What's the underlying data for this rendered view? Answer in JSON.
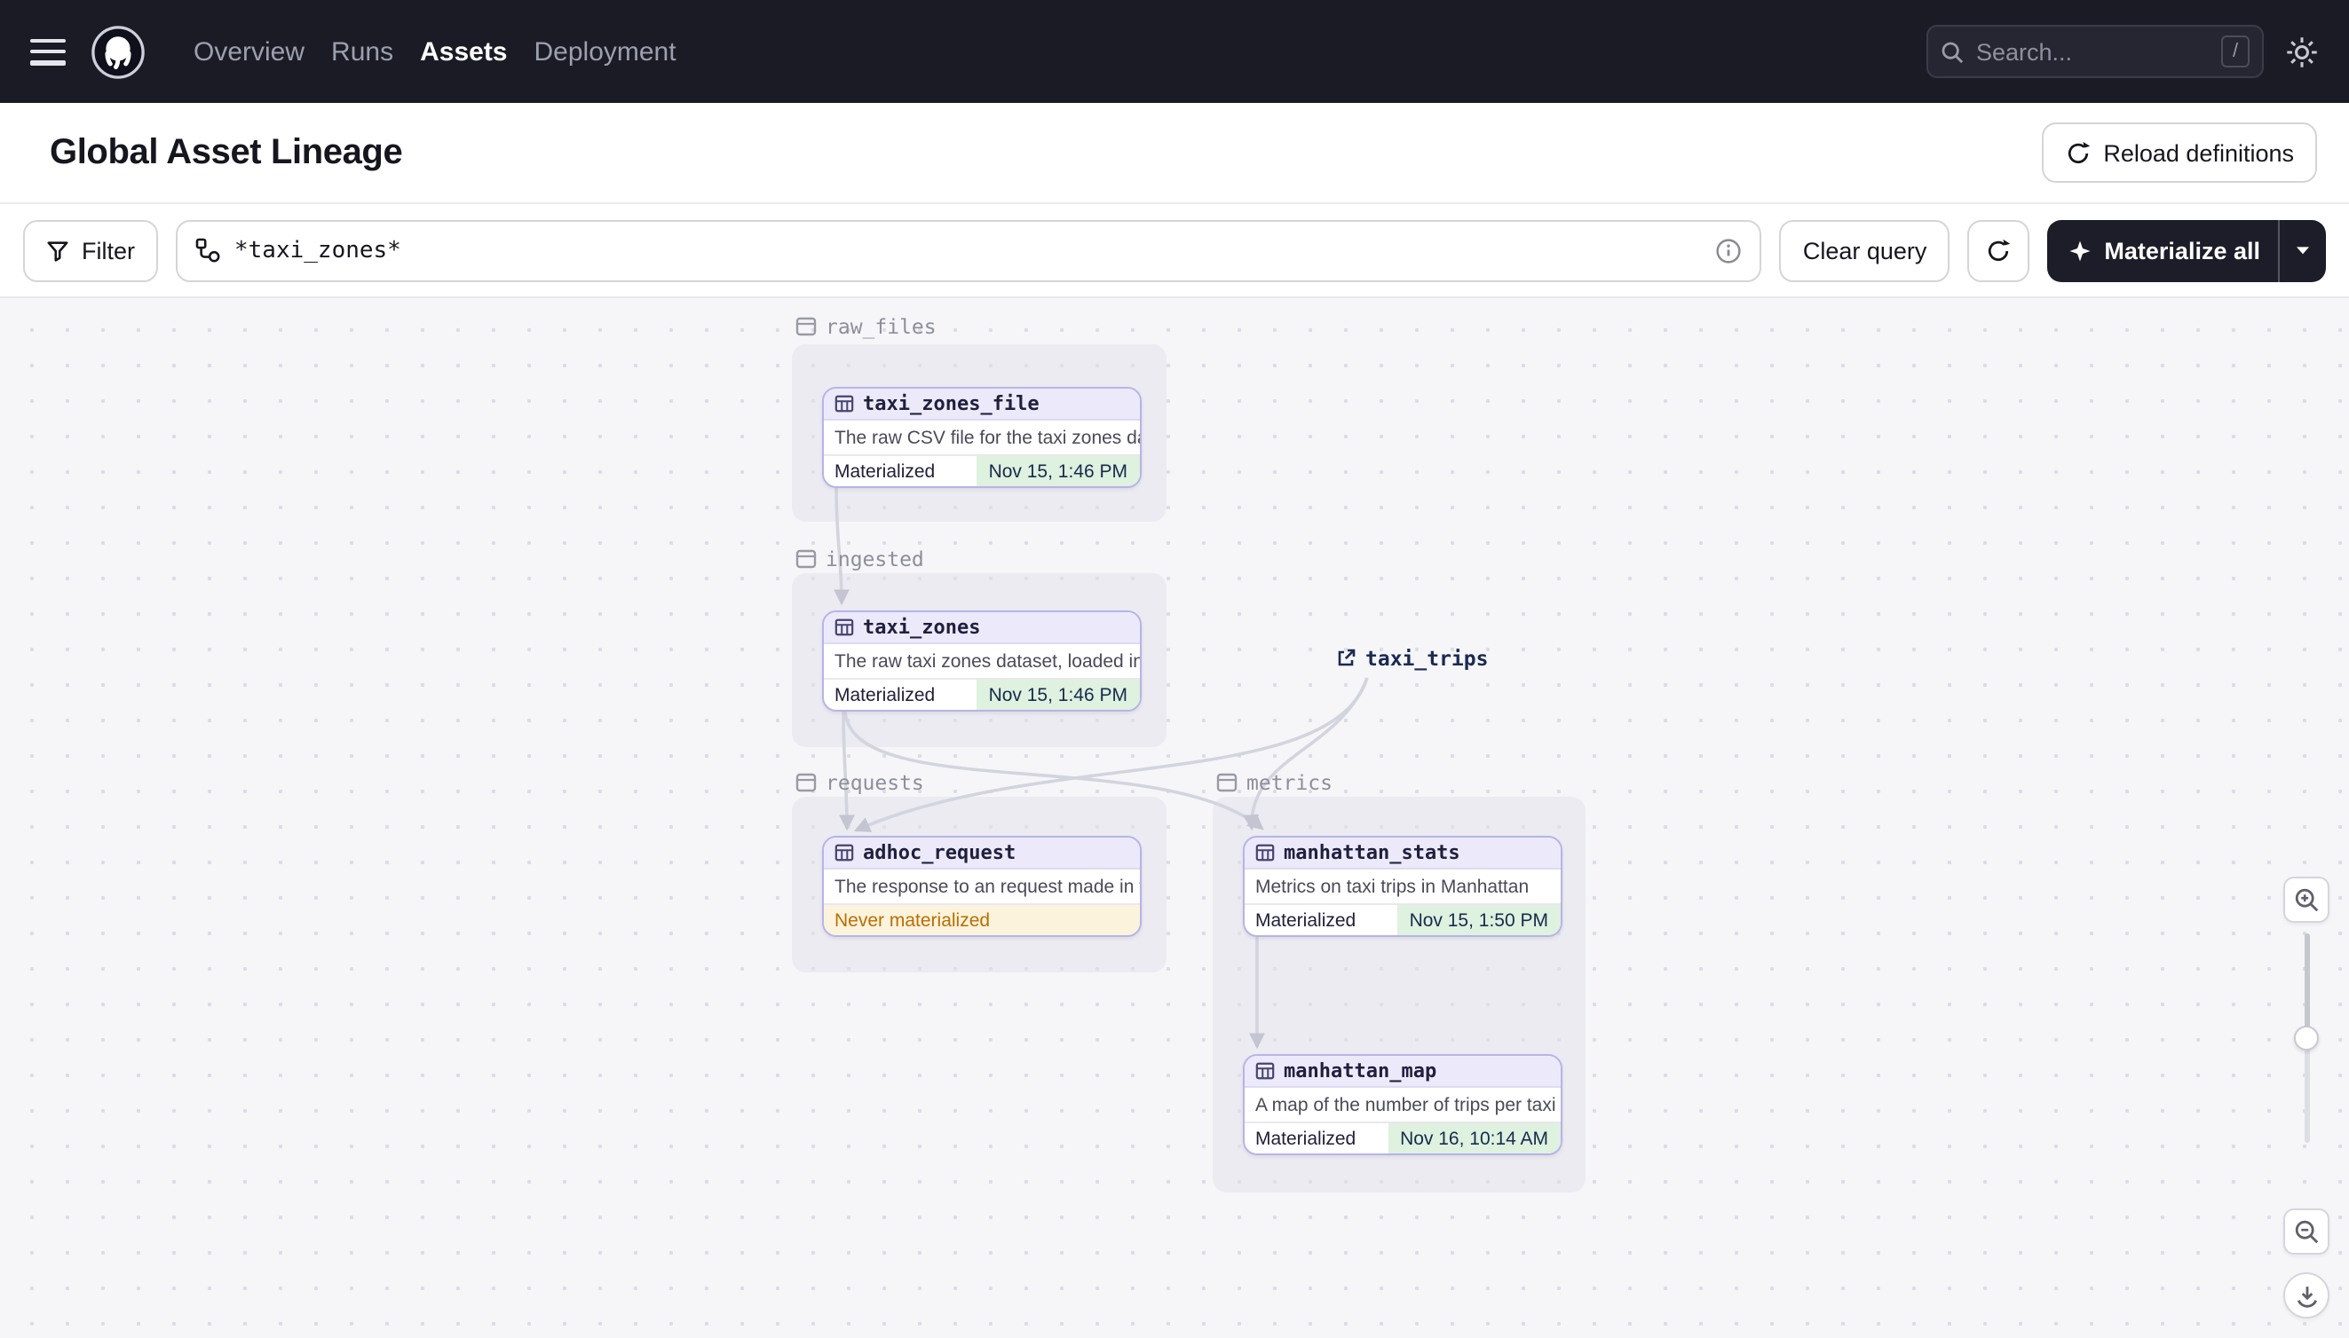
{
  "topnav": {
    "items": [
      {
        "label": "Overview",
        "active": false
      },
      {
        "label": "Runs",
        "active": false
      },
      {
        "label": "Assets",
        "active": true
      },
      {
        "label": "Deployment",
        "active": false
      }
    ],
    "search": {
      "placeholder": "Search...",
      "shortcut_key": "/"
    }
  },
  "header": {
    "title": "Global Asset Lineage",
    "reload_button_label": "Reload definitions"
  },
  "toolbar": {
    "filter_button_label": "Filter",
    "query_value": "*taxi_zones*",
    "clear_query_label": "Clear query",
    "materialize_button_label": "Materialize all"
  },
  "graph": {
    "groups": [
      {
        "name": "raw_files"
      },
      {
        "name": "ingested"
      },
      {
        "name": "requests"
      },
      {
        "name": "metrics"
      }
    ],
    "nodes": [
      {
        "title": "taxi_zones_file",
        "group": "raw_files",
        "description": "The raw CSV file for the taxi zones dat...",
        "status": "Materialized",
        "timestamp": "Nov 15, 1:46 PM"
      },
      {
        "title": "taxi_zones",
        "group": "ingested",
        "description": "The raw taxi zones dataset, loaded int...",
        "status": "Materialized",
        "timestamp": "Nov 15, 1:46 PM"
      },
      {
        "title": "adhoc_request",
        "group": "requests",
        "description": "The response to an request made in th...",
        "status": "Never materialized",
        "timestamp": ""
      },
      {
        "title": "manhattan_stats",
        "group": "metrics",
        "description": "Metrics on taxi trips in Manhattan",
        "status": "Materialized",
        "timestamp": "Nov 15, 1:50 PM"
      },
      {
        "title": "manhattan_map",
        "group": "metrics",
        "description": "A map of the number of trips per taxi z...",
        "status": "Materialized",
        "timestamp": "Nov 16, 10:14 AM"
      }
    ],
    "external_assets": [
      {
        "title": "taxi_trips"
      }
    ],
    "edges": [
      {
        "from": "taxi_zones_file",
        "to": "taxi_zones"
      },
      {
        "from": "taxi_zones",
        "to": "adhoc_request"
      },
      {
        "from": "taxi_zones",
        "to": "manhattan_stats"
      },
      {
        "from": "taxi_trips",
        "to": "adhoc_request"
      },
      {
        "from": "taxi_trips",
        "to": "manhattan_stats"
      },
      {
        "from": "manhattan_stats",
        "to": "manhattan_map"
      }
    ]
  },
  "colors": {
    "topnav_bg": "#1b1b26",
    "accent_dark": "#1d1d2a",
    "node_border": "#b7b3ea",
    "node_header_bg": "#eceafa",
    "materialized_bg": "#dff1df",
    "materialized_text": "#172b4d",
    "never_materialized_text": "#ba6e00",
    "never_materialized_bg": "#fcf3dd",
    "edge": "#d4d4df",
    "canvas_bg": "#f6f6f9"
  }
}
